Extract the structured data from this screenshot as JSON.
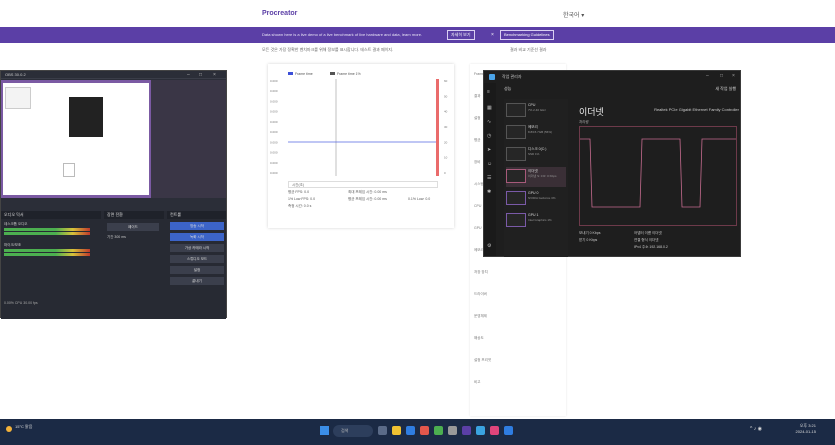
{
  "site": {
    "logo": "Procreator",
    "lang": "한국어 ▾",
    "banner_text": "Data shown here is a live demo of a live benchmark of live hardware and data, learn more.",
    "banner_btn1": "자세히 보기",
    "banner_btn2": "Benchmarking Guidelines",
    "subtitle": "모든 것은 가장 정확한 벤치마크를 위해 정보를 표시합니다. 테스트 결과 페이지.",
    "subtitle2": "결과 비교 기준선 결과"
  },
  "chart": {
    "legend_a": "Frame time",
    "legend_b": "Frame time 1%",
    "y_ticks_left": [
      "0.000",
      "0.000",
      "0.000",
      "0.000",
      "0.000",
      "0.000",
      "0.000",
      "0.000",
      "0.000",
      "0.000"
    ],
    "y_ticks_right": [
      "60",
      "50",
      "40",
      "30",
      "20",
      "10",
      "0"
    ],
    "x_label": "시간(초)",
    "summary": [
      "평균 FPS: 0.0",
      "최대 프레임 시간: 0.00 ms",
      "1% Low FPS: 0.0",
      "평균 프레임 시간: 0.00 ms",
      "0.1% Low: 0.0",
      "측정 시간: 0.0 s"
    ]
  },
  "right_panel": {
    "items": [
      "Frametime",
      "결과",
      "설정",
      "평균",
      "장비",
      "시스템",
      "CPU",
      "GPU",
      "메모리",
      "저장 장치",
      "드라이버",
      "운영체제",
      "해상도",
      "설정 프리셋",
      "비고"
    ]
  },
  "obs": {
    "title": "OBS 30.0.2",
    "panels": [
      "오디오 믹서",
      "장면 전환",
      "컨트롤"
    ],
    "audio_tracks": [
      "데스크톱 오디오",
      "마이크/보조"
    ],
    "transition": "페이드",
    "duration_label": "기간 300 ms",
    "buttons": [
      "방송 시작",
      "녹화 시작",
      "가상 카메라 시작",
      "스튜디오 모드",
      "설정",
      "끝내기"
    ],
    "status": "0.00% CPU 30.00 fps"
  },
  "taskmgr": {
    "title": "작업 관리자",
    "run_task": "새 작업 실행",
    "section": "성능",
    "main_title": "이더넷",
    "device": "Realtek PCIe Gigabit Ethernet Family Controller",
    "graph_label": "처리량",
    "items": [
      {
        "name": "CPU",
        "sub": "7% 2.40 GHz"
      },
      {
        "name": "메모리",
        "sub": "8.8/15.7GB (56%)"
      },
      {
        "name": "디스크 0(C:)",
        "sub": "SSD 1%"
      },
      {
        "name": "이더넷",
        "sub": "이더넷 S: 0 R: 0 Kbps"
      },
      {
        "name": "GPU 0",
        "sub": "NVIDIA GeForce 3%"
      },
      {
        "name": "GPU 1",
        "sub": "Intel Graphics 1%"
      }
    ],
    "stats": [
      "보내기 0 Kbps",
      "받기 0 Kbps",
      "어댑터 이름 이더넷",
      "연결 형식 이더넷",
      "IPv4 주소 192.168.0.2"
    ]
  },
  "taskbar": {
    "search": "검색",
    "weather": "15°C 맑음",
    "time": "오후 3:21",
    "date": "2024-01-15"
  }
}
